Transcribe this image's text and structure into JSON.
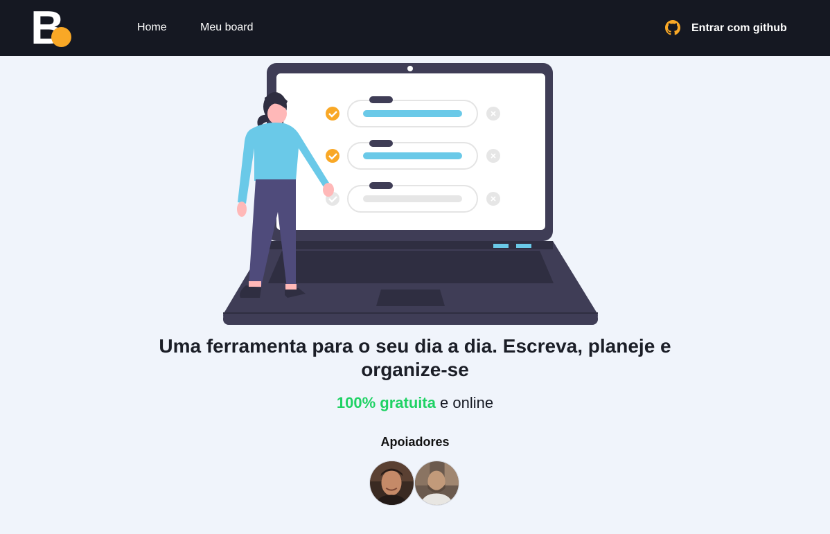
{
  "header": {
    "logo": {
      "letter": "B"
    },
    "nav": [
      {
        "label": "Home"
      },
      {
        "label": "Meu board"
      }
    ],
    "login": {
      "label": "Entrar com github",
      "icon": "github-icon"
    }
  },
  "hero": {
    "illustration": "person-with-laptop-checklist",
    "headline": "Uma ferramenta para o seu dia a dia. Escreva, planeje e organize-se",
    "highlight": "100% gratuita",
    "subline_rest": " e online"
  },
  "supporters": {
    "title": "Apoiadores",
    "avatars": [
      "avatar-1",
      "avatar-2"
    ]
  },
  "colors": {
    "topbar": "#151822",
    "accent": "#f9a826",
    "highlight": "#1fd264",
    "background": "#f0f4fb",
    "laptop": "#3f3d56",
    "bar": "#6ac9e8"
  }
}
